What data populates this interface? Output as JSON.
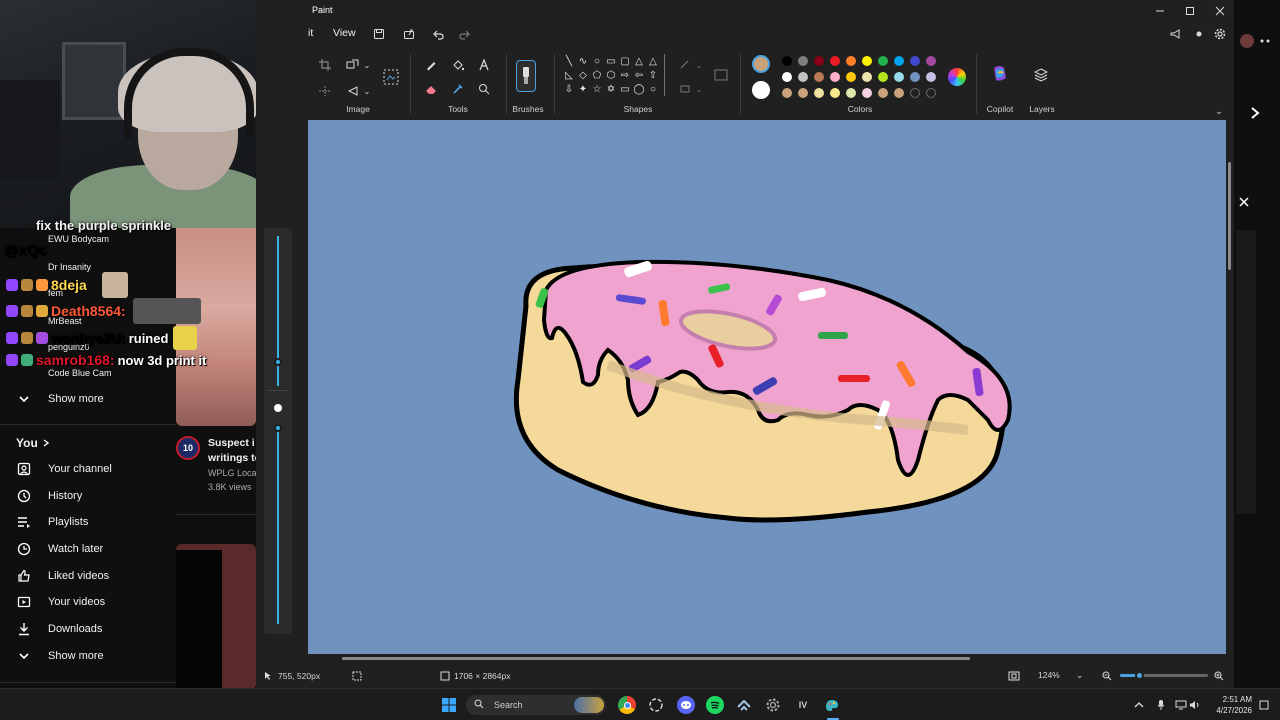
{
  "youtube": {
    "sidebar": {
      "you_label": "You",
      "items": [
        {
          "label": "Your channel",
          "icon": "channel-icon"
        },
        {
          "label": "History",
          "icon": "history-icon"
        },
        {
          "label": "Playlists",
          "icon": "playlists-icon"
        },
        {
          "label": "Watch later",
          "icon": "watch-later-icon"
        },
        {
          "label": "Liked videos",
          "icon": "thumbs-up-icon"
        },
        {
          "label": "Your videos",
          "icon": "your-videos-icon"
        },
        {
          "label": "Downloads",
          "icon": "download-icon"
        },
        {
          "label": "Show more",
          "icon": "chevron-down-icon"
        }
      ],
      "subscriptions_show_more": "Show more",
      "subscriptions": [
        "EWU Bodycam",
        "Dr Insanity",
        "fem",
        "MrBeast",
        "penguinz0",
        "Code Blue Cam"
      ]
    },
    "recommended": {
      "channel_badge": "10",
      "title_line1": "Suspect i",
      "title_line2": "writings to",
      "channel": "WPLG Loca",
      "views": "3.8K views"
    }
  },
  "chat": {
    "messages": [
      {
        "user": "@xQc",
        "msg": "",
        "user_color": "#ffffff"
      },
      {
        "user": "8deja",
        "msg": "",
        "user_color": "#ffd84d"
      },
      {
        "user": "Death8564:",
        "msg": "",
        "user_color": "#ff5a36"
      },
      {
        "user": "wonhye2U:",
        "msg": "ruined",
        "user_color": "#ffffff"
      },
      {
        "user": "samrob168:",
        "msg": "now 3d print it",
        "user_color": "#e0152b"
      }
    ],
    "top_partial": "fix the purple sprinkle"
  },
  "paint": {
    "app_title": "Paint",
    "menu": {
      "edit_partial": "it",
      "view": "View"
    },
    "ribbon": {
      "image": "Image",
      "tools": "Tools",
      "brushes": "Brushes",
      "shapes": "Shapes",
      "colors": "Colors",
      "copilot": "Copilot",
      "layers": "Layers"
    },
    "colors": {
      "primary": "#c8a27a",
      "secondary": "#ffffff",
      "row1": [
        "#000000",
        "#7f7f7f",
        "#880015",
        "#ed1c24",
        "#ff7f27",
        "#fff200",
        "#22b14c",
        "#00a2e8",
        "#3f48cc",
        "#a349a4"
      ],
      "row2": [
        "#ffffff",
        "#c3c3c3",
        "#b97a57",
        "#ffaec9",
        "#ffc90e",
        "#efe4b0",
        "#b5e61d",
        "#99d9ea",
        "#7092be",
        "#c8bfe7"
      ],
      "row3": [
        "#c8a27a",
        "#c8a27a",
        "#efe0a0",
        "#f5e98e",
        "#dfe7a8",
        "#f3d0e0",
        "#c8a27a",
        "#c8a27a",
        "",
        ""
      ],
      "canvas_bg": "#6f93be"
    },
    "status": {
      "cursor": "755, 520px",
      "dimensions": "1706 × 2864px",
      "zoom": "124%",
      "zoom_level": 0.22
    }
  },
  "taskbar": {
    "search_placeholder": "Search",
    "time": "2:51 AM",
    "date": "4/27/2026"
  }
}
